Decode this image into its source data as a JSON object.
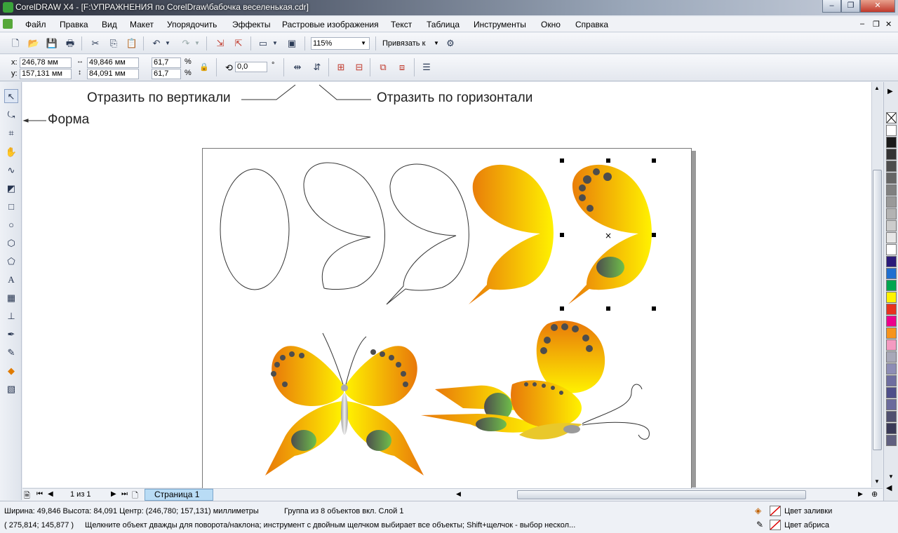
{
  "window": {
    "title": "CorelDRAW X4 - [F:\\УПРАЖНЕНИЯ по CorelDraw\\бабочка веселенькая.cdr]"
  },
  "menu": [
    "Файл",
    "Правка",
    "Вид",
    "Макет",
    "Упорядочить",
    "Эффекты",
    "Растровые изображения",
    "Текст",
    "Таблица",
    "Инструменты",
    "Окно",
    "Справка"
  ],
  "toolbar": {
    "zoom": "115%",
    "snap_label": "Привязать к"
  },
  "properties": {
    "x": "246,78 мм",
    "y": "157,131 мм",
    "width": "49,846 мм",
    "height": "84,091 мм",
    "scale_x": "61,7",
    "scale_y": "61,7",
    "percent": "%",
    "rotation": "0,0",
    "degree": "°"
  },
  "annotations": {
    "mirror_vertical": "Отразить по вертикали",
    "mirror_horizontal": "Отразить по горизонтали",
    "shape": "Форма"
  },
  "pagenav": {
    "counter": "1 из 1",
    "tab": "Страница 1"
  },
  "status": {
    "size": "Ширина: 49,846 Высота: 84,091 Центр: (246,780; 157,131) миллиметры",
    "object": "Группа из 8 объектов вкл. Слой 1",
    "coords": "( 275,814; 145,877 )",
    "hint": "Щелкните объект дважды для поворота/наклона; инструмент с двойным щелчком выбирает все объекты; Shift+щелчок - выбор нескол...",
    "fill": "Цвет заливки",
    "outline": "Цвет абриса"
  },
  "colors": {
    "palette": [
      "#ffffff",
      "#1a1a1a",
      "#333333",
      "#4d4d4d",
      "#666666",
      "#808080",
      "#999999",
      "#b3b3b3",
      "#cccccc",
      "#e6e6e6",
      "#ffffff",
      "#2b1b7a",
      "#1f6fd0",
      "#00a550",
      "#fff200",
      "#e8321e",
      "#ec008c",
      "#f7941d",
      "#f49ac1",
      "#a8a8b8",
      "#8d8db5",
      "#6e6ea0",
      "#4f4f8a",
      "#6b6b9c",
      "#505070",
      "#3a3a58",
      "#606080"
    ]
  }
}
